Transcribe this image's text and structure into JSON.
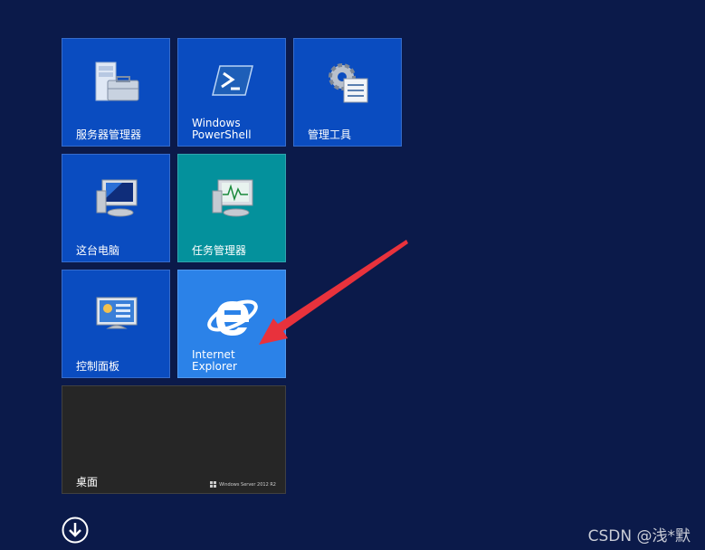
{
  "tiles": [
    {
      "label": "服务器管理器",
      "icon": "server-manager-icon",
      "color": "#0a4cc0"
    },
    {
      "label": "Windows\nPowerShell",
      "icon": "powershell-icon",
      "color": "#0a4cc0"
    },
    {
      "label": "管理工具",
      "icon": "admin-tools-icon",
      "color": "#0a4cc0"
    },
    {
      "label": "这台电脑",
      "icon": "this-pc-icon",
      "color": "#0a4cc0"
    },
    {
      "label": "任务管理器",
      "icon": "task-manager-icon",
      "color": "#04919c"
    },
    {
      "label": "控制面板",
      "icon": "control-panel-icon",
      "color": "#0a4cc0"
    },
    {
      "label": "Internet\nExplorer",
      "icon": "internet-explorer-icon",
      "color": "#2b82e8"
    },
    {
      "label": "桌面",
      "icon": "desktop-tile",
      "color": "#262626"
    }
  ],
  "desktop_brand": "Windows Server 2012 R2",
  "all_apps_icon": "down-arrow-circle-icon",
  "watermark": "CSDN @浅*默",
  "annotation": {
    "type": "red-arrow",
    "color": "#e8323c"
  }
}
